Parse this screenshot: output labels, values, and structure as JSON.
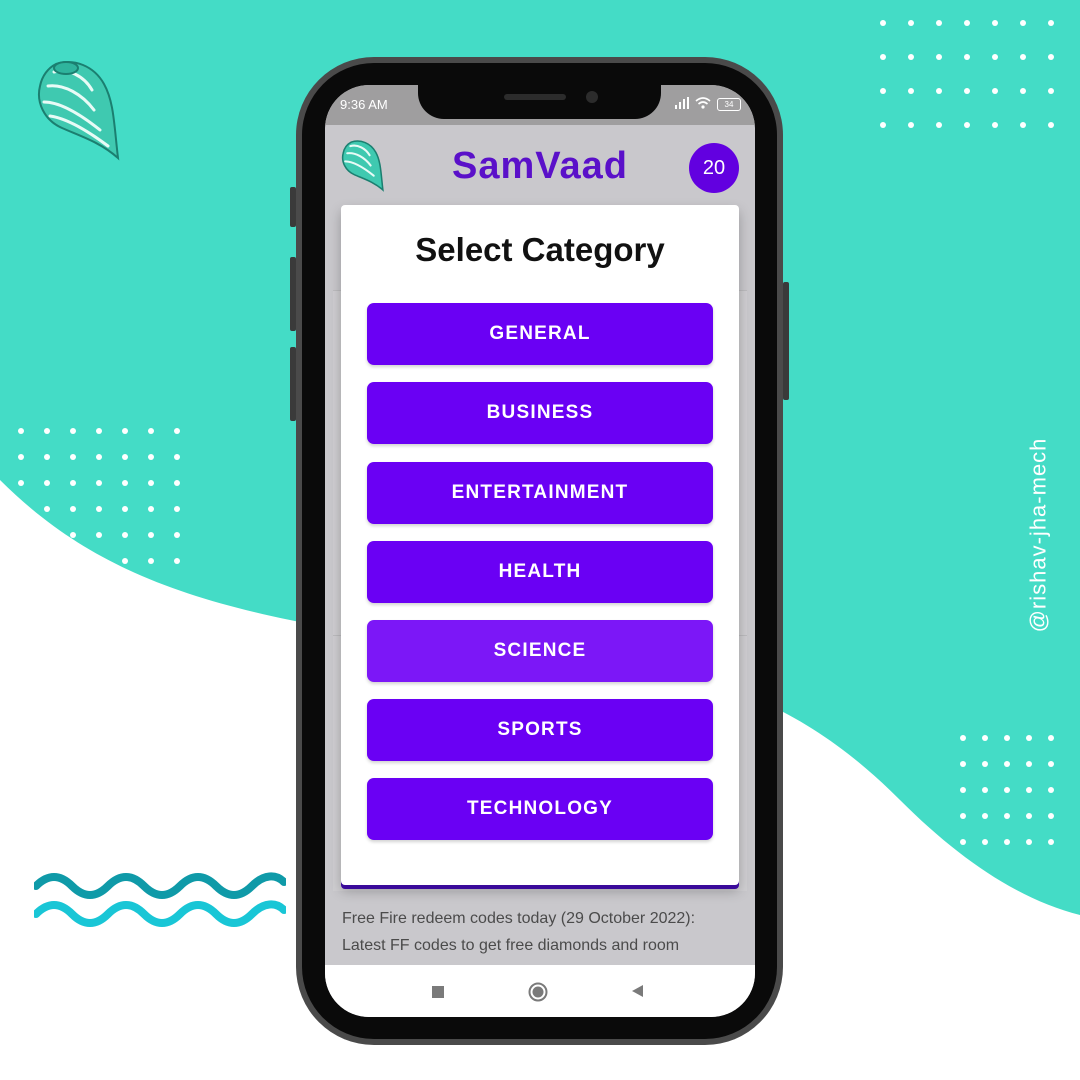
{
  "watermark": {
    "handle": "@rishav-jha-mech"
  },
  "status_bar": {
    "time": "9:36 AM",
    "battery": "34"
  },
  "app_bar": {
    "title": "SamVaad",
    "count": "20",
    "title_color": "#5a10c9",
    "accent": "#6200e0"
  },
  "dialog": {
    "title": "Select Category",
    "categories": [
      "GENERAL",
      "BUSINESS",
      "ENTERTAINMENT",
      "HEALTH",
      "SCIENCE",
      "SPORTS",
      "TECHNOLOGY"
    ],
    "pressed_category": "SCIENCE",
    "button_color": "#6a00f4"
  },
  "article_preview": {
    "text": "Free Fire redeem codes today (29 October 2022): Latest FF codes to get free diamonds and room"
  },
  "nav_bar": {
    "icons": [
      "square-icon",
      "circle-icon",
      "triangle-back-icon"
    ]
  },
  "decor": {
    "background_teal": "#44dcc6",
    "wave_colors": [
      "#0f9aa8",
      "#19c6d6"
    ]
  }
}
